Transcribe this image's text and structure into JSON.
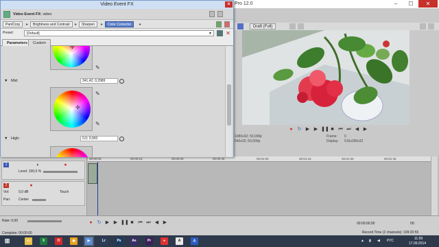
{
  "vegas": {
    "title": "Pro 12.0",
    "window_controls": {
      "minimize": "–",
      "maximize": "☐",
      "close": "✕"
    },
    "preview": {
      "quality": "Draft (Full)",
      "project_info": "1080x32; 50,000p",
      "preview_info": "540x32; 50,000p",
      "frame_label": "Frame:",
      "frame_value": "0",
      "display_label": "Display:",
      "display_value": "516x290x32"
    },
    "timeline": {
      "ruler_marks": [
        "00:00:00",
        "00:00:15",
        "00:00:30",
        "00:00:45",
        "00:01:00",
        "00:01:15",
        "00:01:30",
        "00:01:45"
      ],
      "tracks": [
        {
          "number": "1",
          "level": "Level: 100,0 %",
          "color": "#3b5bb5"
        },
        {
          "number": "2",
          "vol": "Vol:",
          "vol_value": "0,0 dB",
          "mode": "Touch",
          "pan": "Pan:",
          "pan_value": "Center",
          "color": "#c0392b"
        }
      ]
    },
    "status": {
      "rate": "Rate: 0,00",
      "complete": "Complete: 00:00:00",
      "time_a": "00:00:00;00",
      "time_b": "00:",
      "record_time": "Record Time (2 channels): 109:20:55"
    }
  },
  "fx": {
    "window_title": "Video Event FX",
    "header_label": "Video Event FX:",
    "header_value": "video",
    "chain": [
      "Pan/Crop",
      "Brightness and Contrast",
      "Sharpen",
      "Color Corrector"
    ],
    "active_chain_index": 3,
    "preset_label": "Preset:",
    "preset_value": "[Default]",
    "tabs": [
      "Parameters",
      "Custom"
    ],
    "sections": {
      "mid_label": "Mid:",
      "mid_value": "341,42; 0,2989",
      "high_label": "High:",
      "high_value": "0,0; 0,000"
    }
  },
  "taskbar": {
    "apps": [
      {
        "name": "file-explorer",
        "glyph": "▭",
        "color": "#e8c04a"
      },
      {
        "name": "excel",
        "glyph": "X",
        "color": "#1f7a3f"
      },
      {
        "name": "opera",
        "glyph": "O",
        "color": "#d42a2a"
      },
      {
        "name": "chrome",
        "glyph": "◉",
        "color": "#e8a020"
      },
      {
        "name": "vegas",
        "glyph": "▶",
        "color": "#5b8ed6"
      },
      {
        "name": "lightroom",
        "glyph": "Lr",
        "color": "#2b3e5a"
      },
      {
        "name": "photoshop",
        "glyph": "Ps",
        "color": "#1c3b63"
      },
      {
        "name": "after-effects",
        "glyph": "Ae",
        "color": "#3a2d6a"
      },
      {
        "name": "premiere",
        "glyph": "Pr",
        "color": "#3e1f58"
      },
      {
        "name": "media-app",
        "glyph": "●",
        "color": "#d33"
      },
      {
        "name": "app-a",
        "glyph": "A",
        "color": "#e8e8e8"
      },
      {
        "name": "app-x",
        "glyph": "⚠",
        "color": "#2c5cc2"
      }
    ],
    "language": "РУС",
    "time": "11:09",
    "date": "17.09.2014"
  }
}
